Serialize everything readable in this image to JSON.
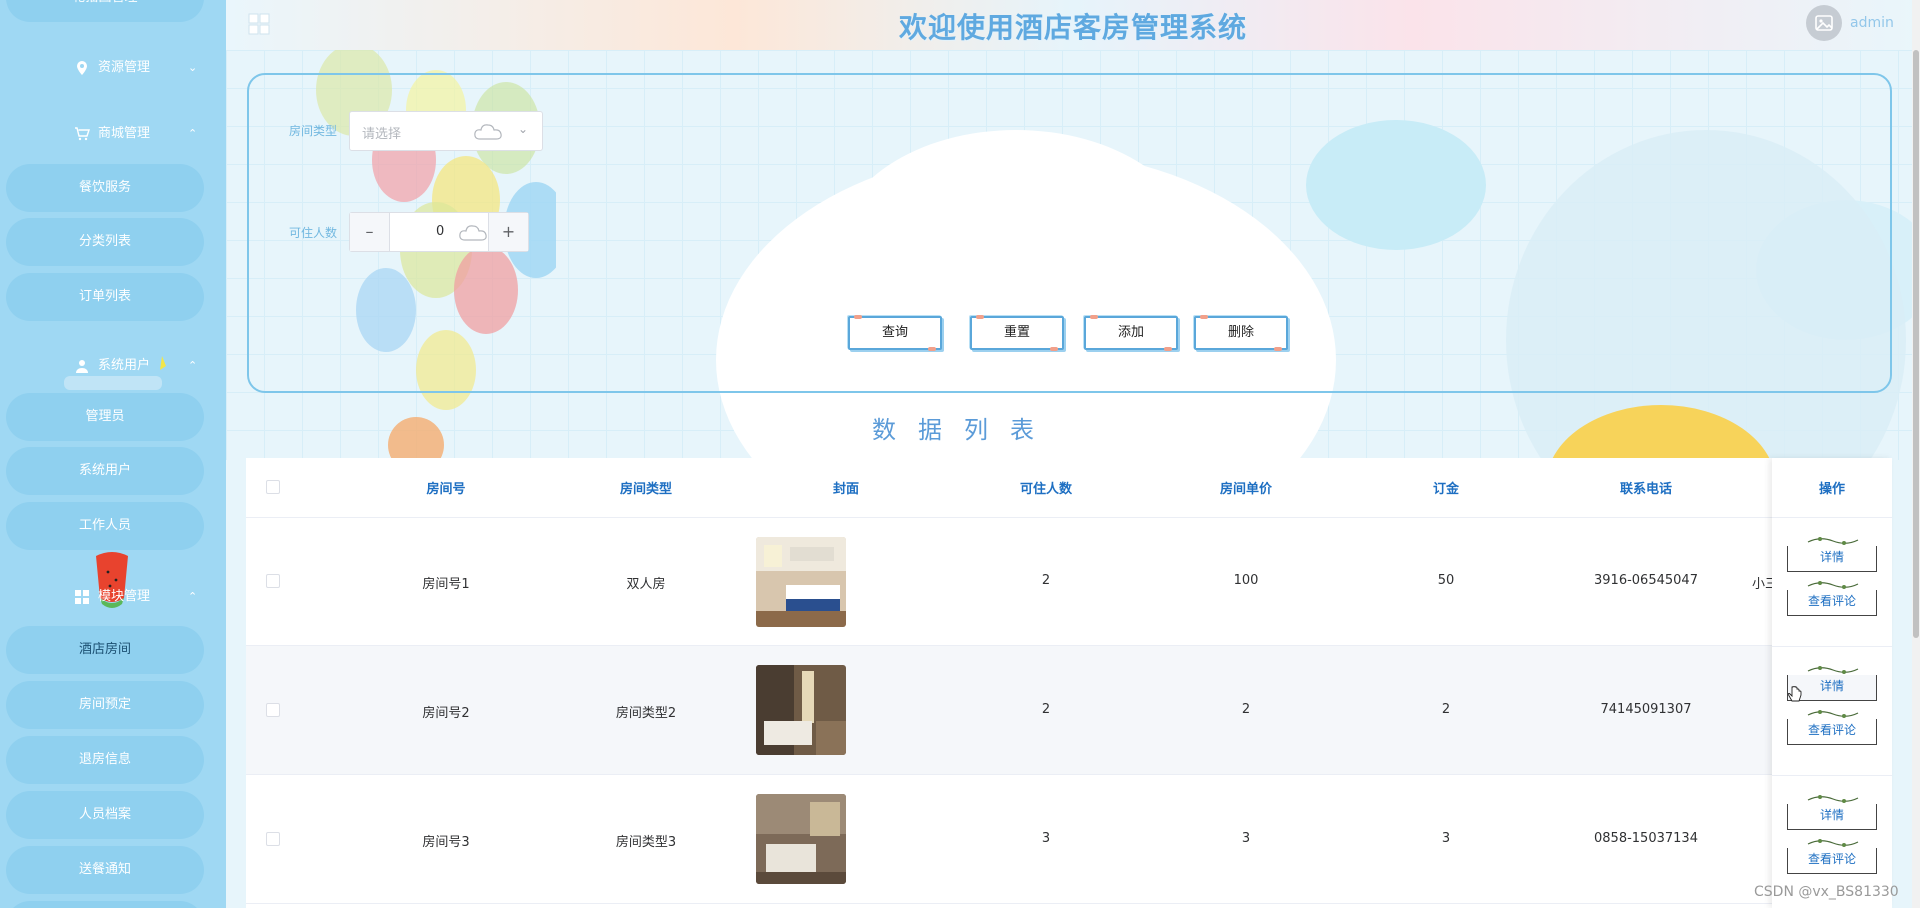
{
  "app": {
    "title": "欢迎使用酒店客房管理系统",
    "user": "admin"
  },
  "sidebar": {
    "top_cut_item": "轮播图管理",
    "groups": {
      "resource": "资源管理",
      "mall": "商城管理",
      "system_user": "系统用户",
      "module": "模块管理"
    },
    "mall_items": [
      "餐饮服务",
      "分类列表",
      "订单列表"
    ],
    "user_items": [
      "管理员",
      "系统用户",
      "工作人员"
    ],
    "module_items": [
      "酒店房间",
      "房间预定",
      "退房信息",
      "人员档案",
      "送餐通知"
    ],
    "active_item": "酒店房间"
  },
  "search": {
    "room_type_label": "房间类型",
    "room_type_placeholder": "请选择",
    "capacity_label": "可住人数",
    "capacity_value": "0",
    "buttons": {
      "query": "查询",
      "reset": "重置",
      "add": "添加",
      "delete": "删除"
    }
  },
  "list_title": "数据列表",
  "table": {
    "headers": [
      "房间号",
      "房间类型",
      "封面",
      "可住人数",
      "房间单价",
      "订金",
      "联系电话",
      "操作"
    ],
    "rows": [
      {
        "room_no": "房间号1",
        "type": "双人房",
        "capacity": "2",
        "price": "100",
        "deposit": "50",
        "phone": "3916-06545047",
        "overflow_text": "小三"
      },
      {
        "room_no": "房间号2",
        "type": "房间类型2",
        "capacity": "2",
        "price": "2",
        "deposit": "2",
        "phone": "74145091307",
        "overflow_text": ""
      },
      {
        "room_no": "房间号3",
        "type": "房间类型3",
        "capacity": "3",
        "price": "3",
        "deposit": "3",
        "phone": "0858-15037134",
        "overflow_text": ""
      }
    ],
    "op_labels": {
      "detail": "详情",
      "reviews": "查看评论"
    }
  },
  "watermark": "CSDN @vx_BS81330",
  "colors": {
    "sidebar_bg": "#9fd8f3",
    "sidebar_pill": "#8fd0ef",
    "accent_blue": "#1e6fc2",
    "title_blue": "#5fa9e0",
    "panel_border": "#7ec6ea"
  },
  "icons": {
    "resource": "location-pin-icon",
    "mall": "cart-icon",
    "system_user": "user-icon",
    "module": "grid-icon",
    "header_toggle": "grid-icon",
    "avatar": "image-placeholder-icon"
  }
}
